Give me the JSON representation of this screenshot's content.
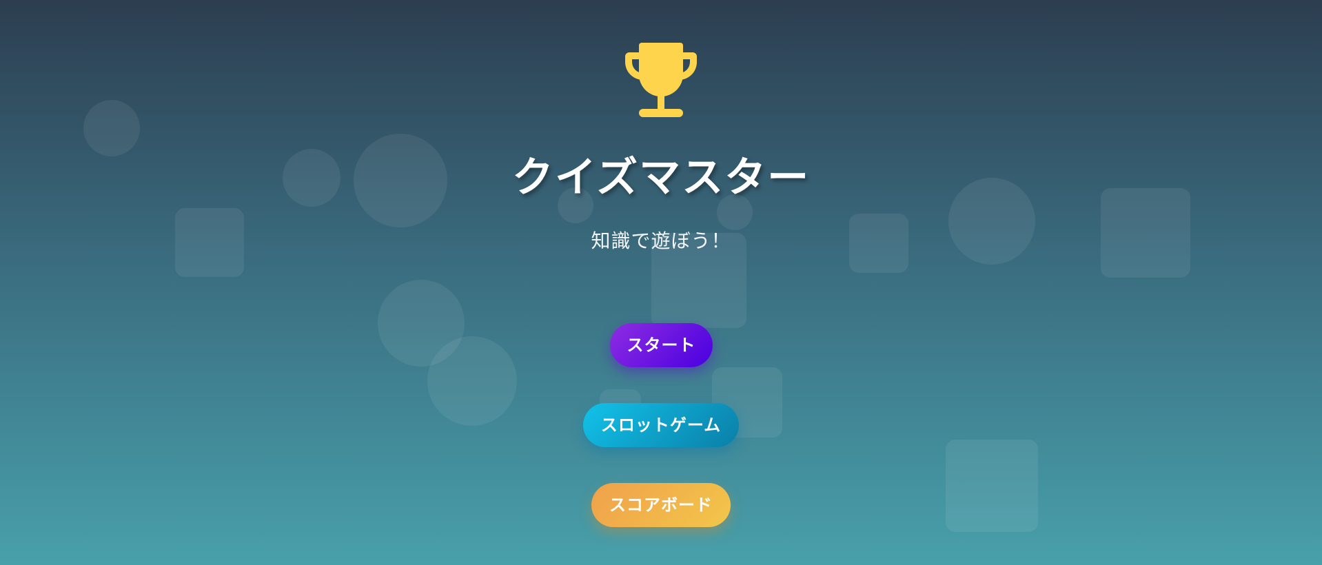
{
  "game": {
    "title": "クイズマスター",
    "subtitle": "知識で遊ぼう！",
    "trophy_icon": "trophy-icon",
    "trophy_color": "#fdd44b"
  },
  "menu": {
    "start_label": "スタート",
    "slot_label": "スロットゲーム",
    "scoreboard_label": "スコアボード"
  },
  "colors": {
    "background_top": "#2c3e50",
    "background_bottom": "#48a0ab",
    "start_button": "#6a1ee6",
    "slot_button": "#0ea5cf",
    "scoreboard_button": "#f1b54a"
  }
}
